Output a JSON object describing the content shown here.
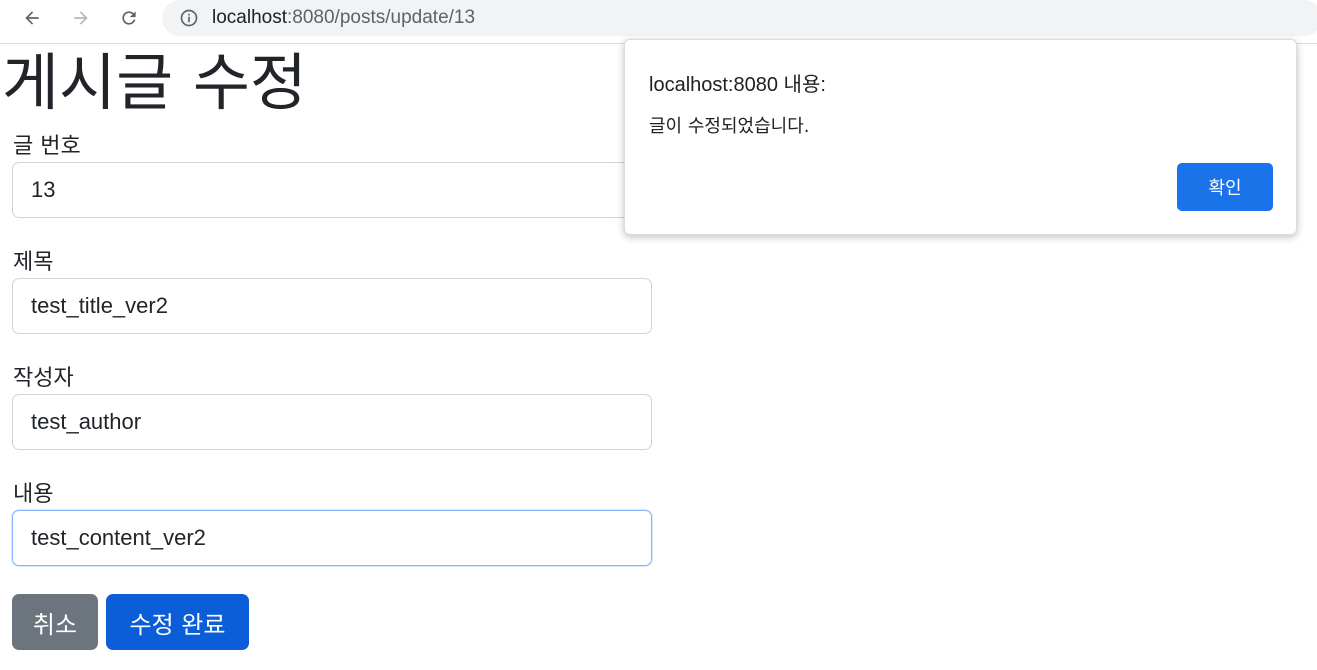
{
  "browser": {
    "url_host": "localhost",
    "url_rest": ":8080/posts/update/13",
    "icons": {
      "back": "arrow-left-icon",
      "forward": "arrow-right-icon",
      "reload": "reload-icon",
      "site_info": "info-icon"
    }
  },
  "page": {
    "title": "게시글 수정",
    "fields": [
      {
        "label": "글 번호",
        "value": "13"
      },
      {
        "label": "제목",
        "value": "test_title_ver2"
      },
      {
        "label": "작성자",
        "value": "test_author"
      },
      {
        "label": "내용",
        "value": "test_content_ver2"
      }
    ],
    "buttons": {
      "cancel": "취소",
      "submit": "수정 완료"
    }
  },
  "dialog": {
    "title": "localhost:8080 내용:",
    "message": "글이 수정되었습니다.",
    "ok_label": "확인"
  },
  "colors": {
    "cancel_button": "#6c757d",
    "submit_button": "#0b5ed7",
    "dialog_ok": "#1a73e8"
  }
}
